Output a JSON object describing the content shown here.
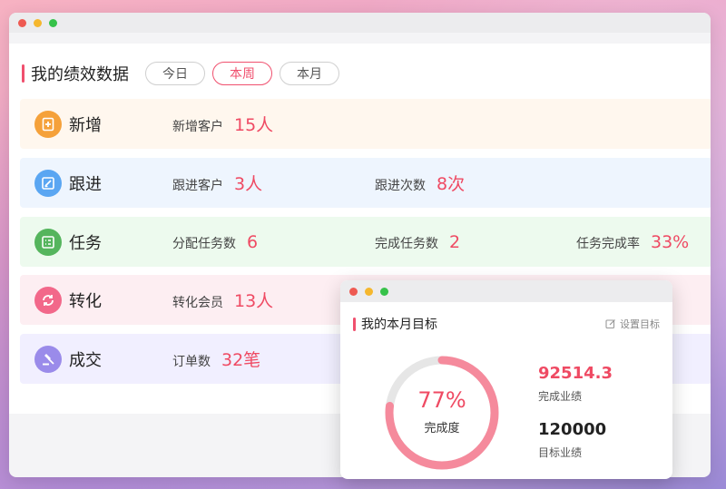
{
  "performance": {
    "title": "我的绩效数据",
    "tabs": [
      {
        "label": "今日",
        "active": false
      },
      {
        "label": "本周",
        "active": true
      },
      {
        "label": "本月",
        "active": false
      }
    ],
    "rows": [
      {
        "name": "新增",
        "icon": "add-file-icon",
        "color": "#f5a13a",
        "bg": "#fff7ee",
        "metrics": [
          {
            "label": "新增客户",
            "value": "15人"
          }
        ]
      },
      {
        "name": "跟进",
        "icon": "edit-icon",
        "color": "#5aa6f2",
        "bg": "#eef5fe",
        "metrics": [
          {
            "label": "跟进客户",
            "value": "3人"
          },
          {
            "label": "跟进次数",
            "value": "8次"
          }
        ]
      },
      {
        "name": "任务",
        "icon": "checklist-icon",
        "color": "#55b55d",
        "bg": "#edfaee",
        "metrics": [
          {
            "label": "分配任务数",
            "value": "6"
          },
          {
            "label": "完成任务数",
            "value": "2"
          },
          {
            "label": "任务完成率",
            "value": "33%"
          }
        ]
      },
      {
        "name": "转化",
        "icon": "convert-icon",
        "color": "#f2688a",
        "bg": "#fdeef2",
        "metrics": [
          {
            "label": "转化会员",
            "value": "13人"
          }
        ]
      },
      {
        "name": "成交",
        "icon": "gavel-icon",
        "color": "#9a8bea",
        "bg": "#f1efff",
        "metrics": [
          {
            "label": "订单数",
            "value": "32笔"
          }
        ]
      }
    ]
  },
  "goal": {
    "title": "我的本月目标",
    "set_label": "设置目标",
    "percent_text": "77%",
    "percent_value": 0.77,
    "percent_label": "完成度",
    "completed_value": "92514.3",
    "completed_label": "完成业绩",
    "target_value": "120000",
    "target_label": "目标业绩"
  },
  "colors": {
    "accent": "#ef4a63",
    "ring_track": "#e6e6e6",
    "ring_fill": "#f58a9c"
  }
}
